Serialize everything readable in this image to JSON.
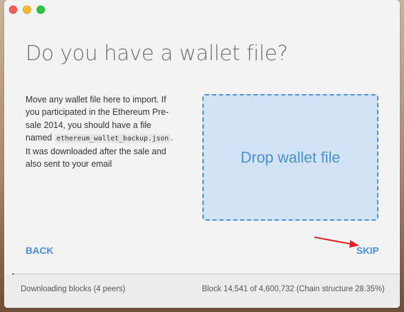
{
  "window": {
    "traffic_lights": {
      "close_color": "#fc5f57",
      "minimize_color": "#fdbc2e",
      "maximize_color": "#29c840"
    }
  },
  "main": {
    "headline": "Do you have a wallet file?",
    "description_part1": "Move any wallet file here to import. If you participated in the Ethereum Pre-sale 2014, you should have a file named",
    "filename": "ethereum_wallet_backup.json",
    "description_part2": ". It was downloaded after the sale and also sent to your email",
    "dropzone_label": "Drop wallet file",
    "back_label": "BACK",
    "skip_label": "SKIP"
  },
  "status": {
    "left_text": "Downloading blocks (4 peers)",
    "right_text": "Block 14,541 of 4,600,732 (Chain structure 28.35%)",
    "progress_fraction": 0.0032
  },
  "colors": {
    "accent": "#4a90d9",
    "dropzone_fill": "#d3e3f7",
    "annotation_arrow": "#e3202a"
  },
  "icons": {
    "annotation": "red-arrow-icon"
  }
}
